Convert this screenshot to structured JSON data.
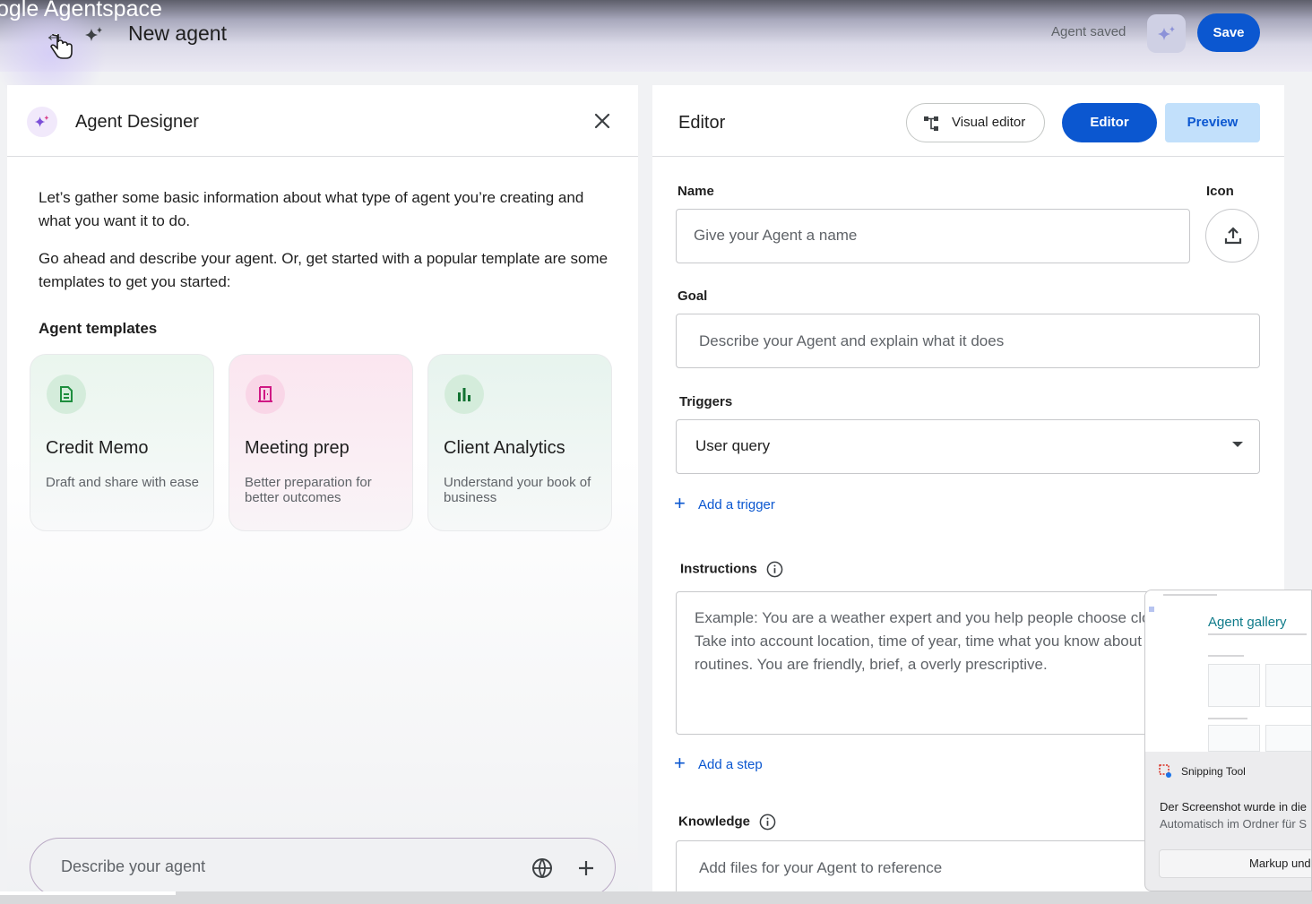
{
  "header": {
    "app_name": "ogle Agentspace",
    "page_title": "New agent",
    "status": "Agent saved",
    "save_label": "Save"
  },
  "designer": {
    "title": "Agent Designer",
    "intro_1": "Let’s gather some basic information about what type of agent you’re creating and what you want it to do.",
    "intro_2": "Go ahead and describe your agent. Or, get started with a popular template are some templates to get you started:",
    "templates_label": "Agent templates",
    "templates": [
      {
        "title": "Credit Memo",
        "description": "Draft and share with ease",
        "icon": "document-icon",
        "color": "#1e8e3e"
      },
      {
        "title": "Meeting prep",
        "description": "Better preparation for better outcomes",
        "icon": "door-icon",
        "color": "#d01884"
      },
      {
        "title": "Client Analytics",
        "description": "Understand your book of business",
        "icon": "bar-chart-icon",
        "color": "#137333"
      }
    ],
    "chat_placeholder": "Describe your agent"
  },
  "editor": {
    "title": "Editor",
    "visual_editor_label": "Visual editor",
    "editor_label": "Editor",
    "preview_label": "Preview",
    "name_label": "Name",
    "name_placeholder": "Give your Agent a name",
    "icon_label": "Icon",
    "goal_label": "Goal",
    "goal_placeholder": "Describe your Agent and explain what it does",
    "triggers_label": "Triggers",
    "trigger_value": "User query",
    "add_trigger": "Add a trigger",
    "instructions_label": "Instructions",
    "instructions_placeholder": "Example: You are a weather expert and you help people choose clothing for the day. Take into account location, time of year, time what you know about their daily routines. You are friendly, brief, a overly prescriptive.",
    "add_step": "Add a step",
    "knowledge_label": "Knowledge",
    "knowledge_placeholder": "Add files for your Agent to reference"
  },
  "toast": {
    "thumb_title": "Agent gallery",
    "app": "Snipping Tool",
    "message_1": "Der Screenshot wurde in die",
    "message_2": "Automatisch im Ordner für S",
    "button": "Markup und"
  },
  "colors": {
    "accent": "#0b57d0",
    "preview_bg": "#c2e0fb"
  }
}
